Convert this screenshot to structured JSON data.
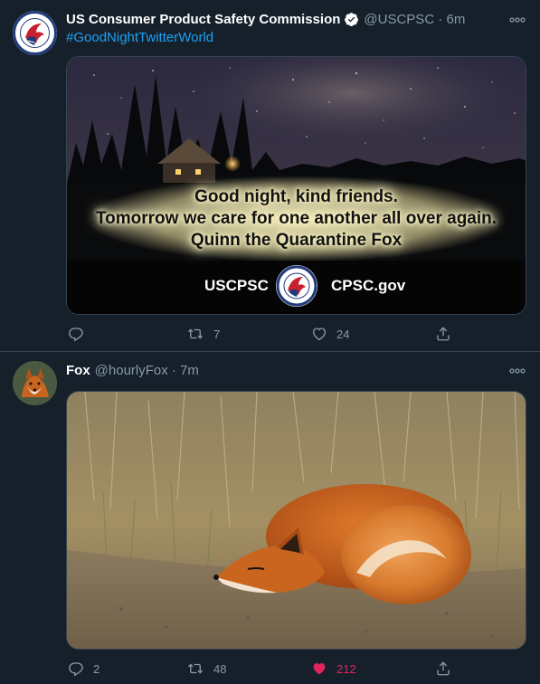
{
  "tweets": [
    {
      "display_name": "US Consumer Product Safety Commission",
      "handle_time": "@USCPSC · 6m",
      "hashtag": "#GoodNightTwitterWorld",
      "verified": true,
      "avatar_icon": "cpsc-seal-icon",
      "image": {
        "line_1": "Good night, kind friends.",
        "line_2": "Tomorrow we care for one another all over again.",
        "line_3": "Quinn the Quarantine Fox",
        "brand_left": "USCPSC",
        "brand_right": "CPSC.gov"
      },
      "actions": {
        "reply": "",
        "retweet": "7",
        "like": "24"
      }
    },
    {
      "display_name": "Fox",
      "handle_time": "@hourlyFox · 7m",
      "avatar_icon": "fox-avatar-icon",
      "actions": {
        "reply": "2",
        "retweet": "48",
        "like": "212",
        "liked": true
      }
    }
  ],
  "colors": {
    "background": "#15202b",
    "border": "#38444d",
    "secondary_text": "#8899a6",
    "link": "#1da1f2",
    "like_active": "#e0245e"
  }
}
